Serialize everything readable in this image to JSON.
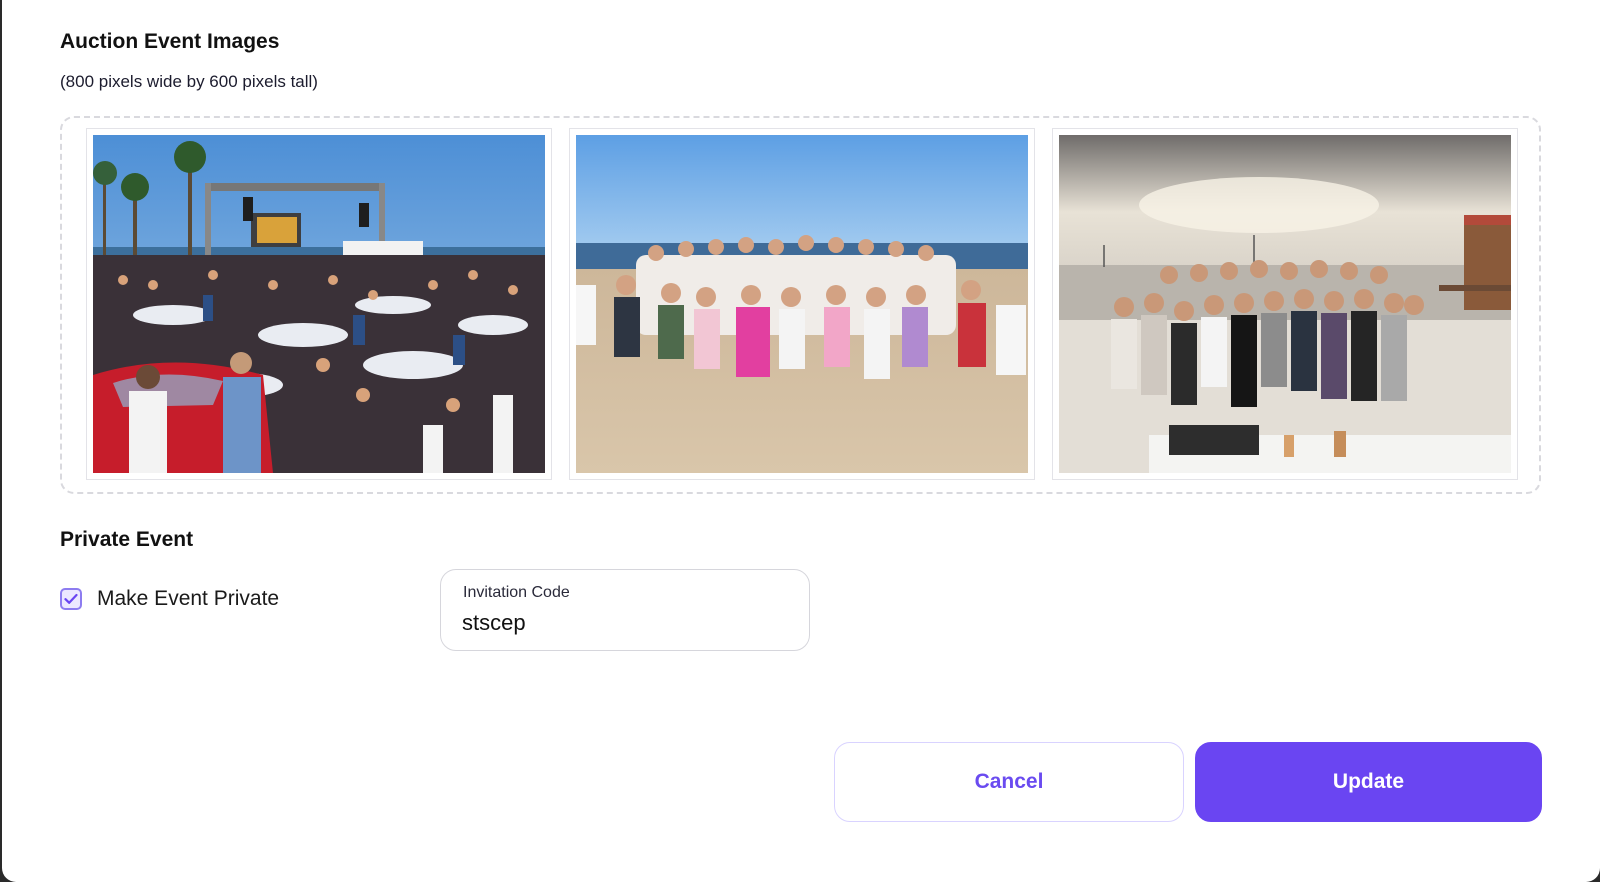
{
  "images_section": {
    "title": "Auction Event Images",
    "hint": "(800 pixels wide by 600 pixels tall)",
    "images": [
      {
        "name": "concert-gala-photo"
      },
      {
        "name": "beach-group-photo"
      },
      {
        "name": "sunset-group-photo"
      }
    ]
  },
  "private_section": {
    "title": "Private Event",
    "checkbox_label": "Make Event Private",
    "checked": true,
    "invitation_label": "Invitation Code",
    "invitation_value": "stscep"
  },
  "actions": {
    "cancel_label": "Cancel",
    "update_label": "Update"
  },
  "colors": {
    "accent": "#6a45f2",
    "checkbox_border": "#8d7cf0",
    "checkbox_fill": "#ece8ff"
  }
}
